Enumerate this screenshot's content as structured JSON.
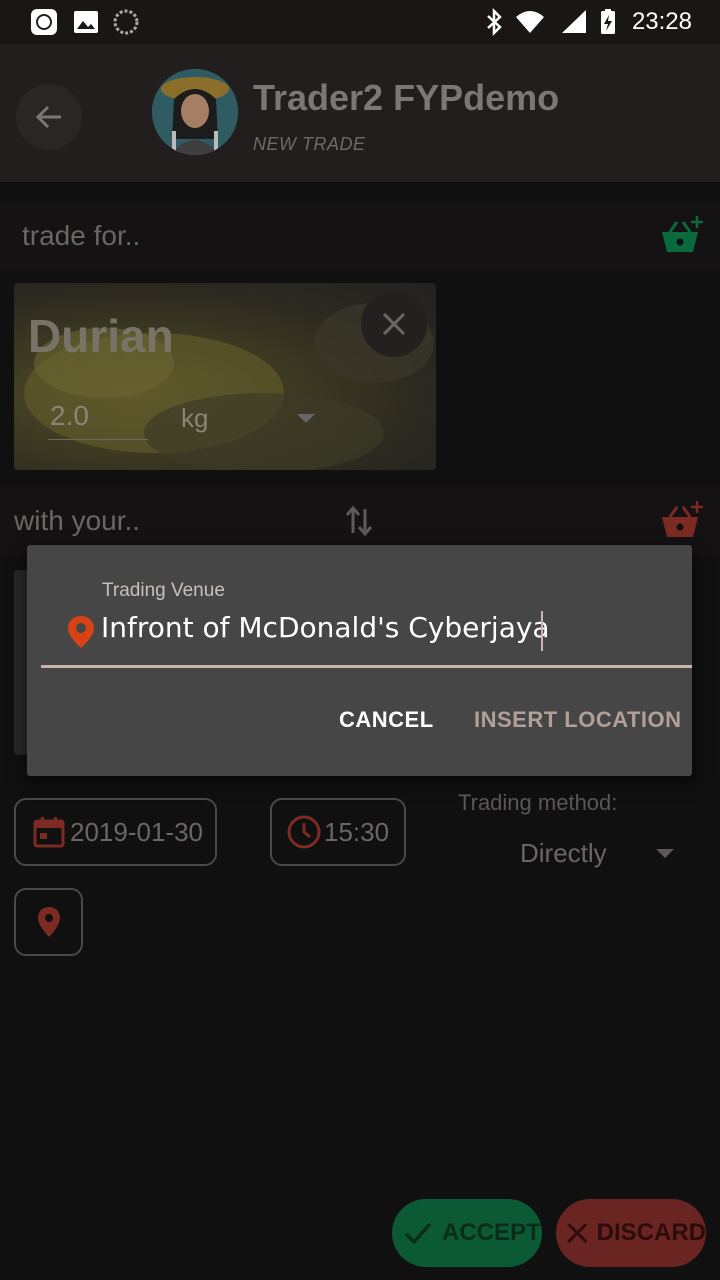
{
  "status_bar": {
    "time": "23:28",
    "icons": [
      "mi-icon",
      "image-icon",
      "loading-icon",
      "bluetooth-icon",
      "wifi-icon",
      "signal-icon",
      "battery-charging-icon"
    ]
  },
  "app_bar": {
    "title": "Trader2 FYPdemo",
    "subtitle": "NEW TRADE"
  },
  "trade_for": {
    "label": "trade for..",
    "item": {
      "name": "Durian",
      "quantity": "2.0",
      "unit": "kg"
    }
  },
  "with_your": {
    "label": "with your.."
  },
  "dialog": {
    "field_label": "Trading Venue",
    "venue_value": "Infront of McDonald's Cyberjaya",
    "cancel_label": "CANCEL",
    "insert_label": "INSERT LOCATION"
  },
  "schedule": {
    "date": "2019-01-30",
    "time": "15:30",
    "method_label": "Trading method:",
    "method_value": "Directly"
  },
  "actions": {
    "accept_label": "ACCEPT",
    "discard_label": "DISCARD"
  },
  "colors": {
    "accent_red": "#d84315",
    "accept_green": "#0f7a45",
    "discard_red": "#a03230",
    "basket_green": "#0b6a3c",
    "basket_red": "#7c2a22"
  }
}
